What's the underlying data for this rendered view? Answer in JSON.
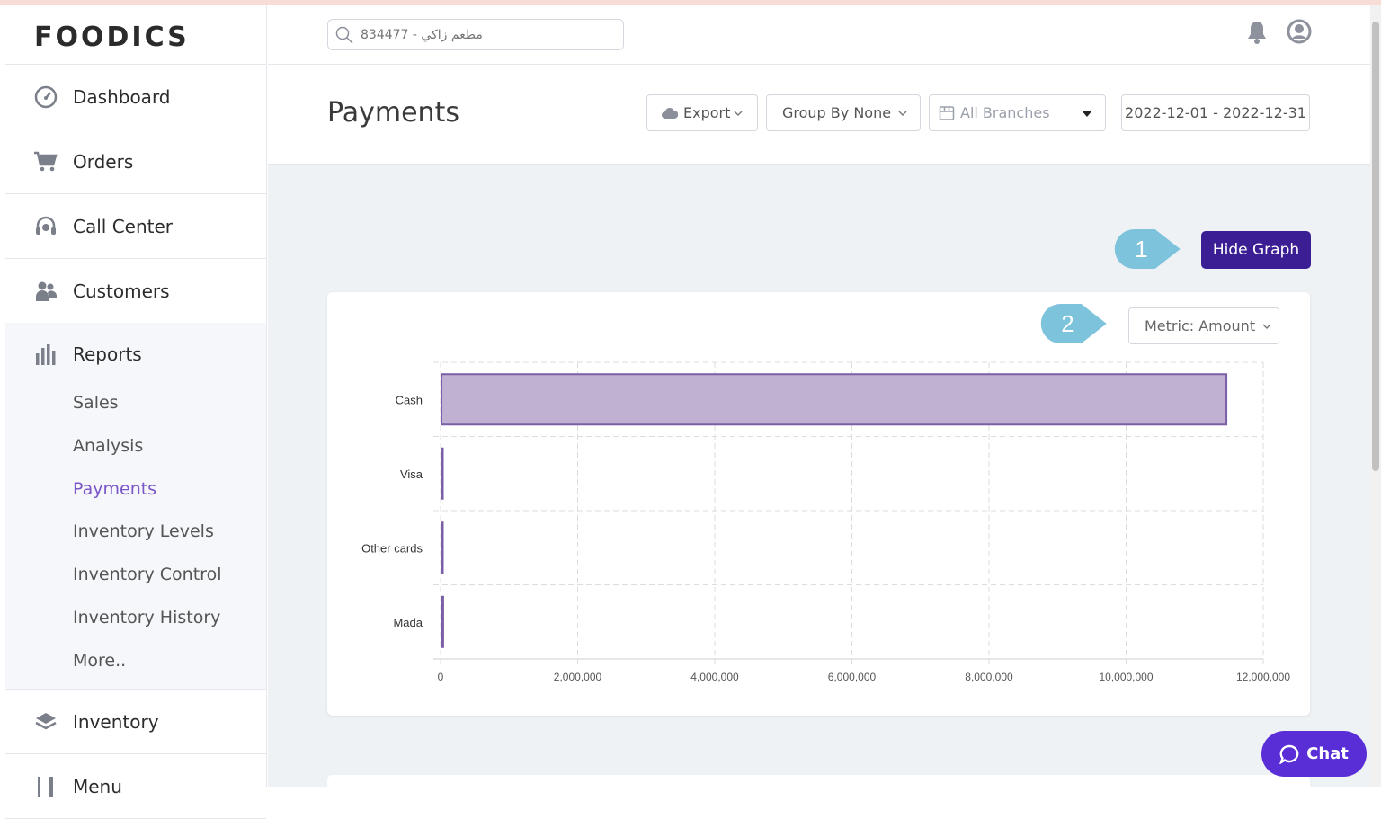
{
  "app": {
    "logo": "FOODICS"
  },
  "search": {
    "placeholder": "834477 - مطعم زاكي"
  },
  "sidebar": {
    "items": [
      {
        "label": "Dashboard"
      },
      {
        "label": "Orders"
      },
      {
        "label": "Call Center"
      },
      {
        "label": "Customers"
      }
    ],
    "reports": {
      "label": "Reports",
      "subitems": [
        {
          "label": "Sales"
        },
        {
          "label": "Analysis"
        },
        {
          "label": "Payments"
        },
        {
          "label": "Inventory Levels"
        },
        {
          "label": "Inventory Control"
        },
        {
          "label": "Inventory History"
        },
        {
          "label": "More.."
        }
      ]
    },
    "bottom": [
      {
        "label": "Inventory"
      },
      {
        "label": "Menu"
      }
    ]
  },
  "page": {
    "title": "Payments",
    "export_label": "Export",
    "group_by_label": "Group By None",
    "branches_label": "All Branches",
    "date_range": "2022-12-01 - 2022-12-31",
    "hide_graph_label": "Hide Graph",
    "metric_label": "Metric: Amount",
    "callout_1": "1",
    "callout_2": "2"
  },
  "chat": {
    "label": "Chat"
  },
  "colors": {
    "accent": "#3b1d94",
    "bar_fill": "#c0b0d1",
    "bar_stroke": "#7a5ea6",
    "callout": "#7ec3dc",
    "active": "#7a56c8"
  },
  "chart_data": {
    "type": "bar",
    "orientation": "horizontal",
    "categories": [
      "Cash",
      "Visa",
      "Other cards",
      "Mada"
    ],
    "values": [
      11450000,
      10000,
      3000,
      25000
    ],
    "xlim": [
      0,
      12000000
    ],
    "xticks": [
      "0",
      "2,000,000",
      "4,000,000",
      "6,000,000",
      "8,000,000",
      "10,000,000",
      "12,000,000"
    ],
    "grid": true
  }
}
